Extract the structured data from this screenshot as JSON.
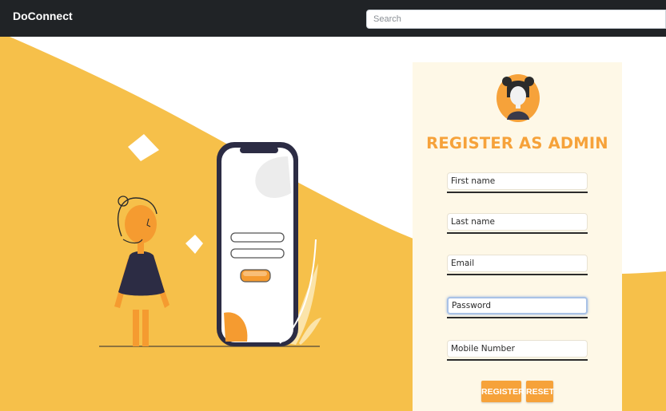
{
  "navbar": {
    "brand": "DoConnect",
    "search_placeholder": "Search"
  },
  "form": {
    "title": "REGISTER AS ADMIN",
    "fields": [
      {
        "placeholder": "First name"
      },
      {
        "placeholder": "Last name"
      },
      {
        "placeholder": "Email"
      },
      {
        "placeholder": "Password"
      },
      {
        "placeholder": "Mobile Number"
      }
    ],
    "register_label": "REGISTER",
    "reset_label": "RESET"
  },
  "colors": {
    "navbar": "#202326",
    "accent": "#f6a23a",
    "hero_yellow": "#f6c04a",
    "card_bg": "#fef8e7"
  },
  "icons": [
    "admin-avatar-icon",
    "person-illustration",
    "phone-illustration"
  ]
}
